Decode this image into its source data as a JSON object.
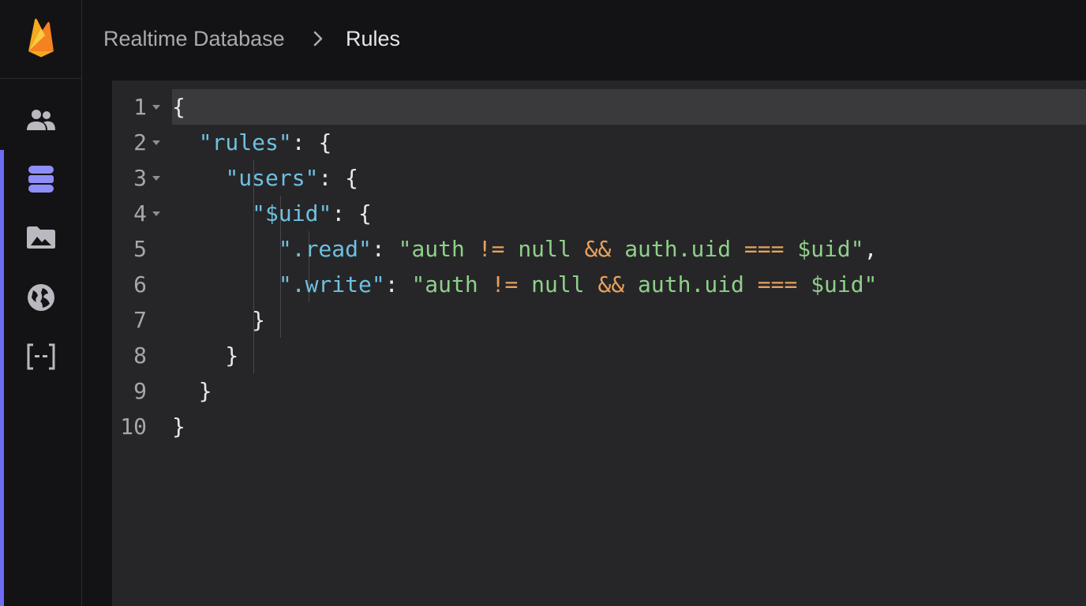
{
  "breadcrumb": {
    "parent": "Realtime Database",
    "separator": ">",
    "current": "Rules"
  },
  "sidebar": {
    "items": [
      {
        "name": "users-icon"
      },
      {
        "name": "database-icon",
        "active": true
      },
      {
        "name": "storage-icon"
      },
      {
        "name": "hosting-icon"
      },
      {
        "name": "functions-icon"
      }
    ]
  },
  "editor": {
    "line_numbers": [
      "1",
      "2",
      "3",
      "4",
      "5",
      "6",
      "7",
      "8",
      "9",
      "10"
    ],
    "lines": [
      {
        "tokens": [
          {
            "t": "pun",
            "v": "{"
          }
        ]
      },
      {
        "tokens": [
          {
            "t": "pun",
            "v": "  "
          },
          {
            "t": "key",
            "v": "\"rules\""
          },
          {
            "t": "pun",
            "v": ": {"
          }
        ]
      },
      {
        "tokens": [
          {
            "t": "pun",
            "v": "    "
          },
          {
            "t": "key",
            "v": "\"users\""
          },
          {
            "t": "pun",
            "v": ": {"
          }
        ]
      },
      {
        "tokens": [
          {
            "t": "pun",
            "v": "      "
          },
          {
            "t": "key",
            "v": "\"$uid\""
          },
          {
            "t": "pun",
            "v": ": {"
          }
        ]
      },
      {
        "tokens": [
          {
            "t": "pun",
            "v": "        "
          },
          {
            "t": "key",
            "v": "\".read\""
          },
          {
            "t": "pun",
            "v": ": "
          },
          {
            "t": "str",
            "v": "\"auth "
          },
          {
            "t": "op",
            "v": "!="
          },
          {
            "t": "str",
            "v": " null "
          },
          {
            "t": "op",
            "v": "&&"
          },
          {
            "t": "str",
            "v": " auth.uid "
          },
          {
            "t": "op",
            "v": "==="
          },
          {
            "t": "str",
            "v": " $uid\""
          },
          {
            "t": "pun",
            "v": ","
          }
        ]
      },
      {
        "tokens": [
          {
            "t": "pun",
            "v": "        "
          },
          {
            "t": "key",
            "v": "\".write\""
          },
          {
            "t": "pun",
            "v": ": "
          },
          {
            "t": "str",
            "v": "\"auth "
          },
          {
            "t": "op",
            "v": "!="
          },
          {
            "t": "str",
            "v": " null "
          },
          {
            "t": "op",
            "v": "&&"
          },
          {
            "t": "str",
            "v": " auth.uid "
          },
          {
            "t": "op",
            "v": "==="
          },
          {
            "t": "str",
            "v": " $uid\""
          }
        ]
      },
      {
        "tokens": [
          {
            "t": "pun",
            "v": "      }"
          }
        ]
      },
      {
        "tokens": [
          {
            "t": "pun",
            "v": "    }"
          }
        ]
      },
      {
        "tokens": [
          {
            "t": "pun",
            "v": "  }"
          }
        ]
      },
      {
        "tokens": [
          {
            "t": "pun",
            "v": "}"
          }
        ]
      }
    ],
    "foldable_lines": [
      1,
      2,
      3,
      4
    ]
  },
  "colors": {
    "key": "#6ec0e0",
    "string": "#8fcf8a",
    "operator": "#e6a15c",
    "punctuation": "#e8e8ea",
    "accent": "#6f6cf4"
  }
}
